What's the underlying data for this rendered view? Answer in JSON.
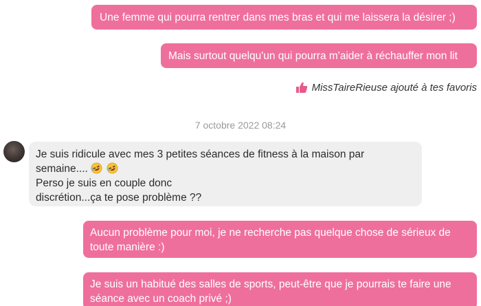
{
  "conversation": {
    "messages": [
      {
        "direction": "sent",
        "lines": [
          "Une femme qui pourra rentrer dans mes bras et qui me laissera la désirer ;)"
        ]
      },
      {
        "direction": "sent",
        "lines": [
          "Mais surtout quelqu'un qui pourra m'aider à réchauffer mon lit"
        ]
      },
      {
        "direction": "received",
        "lines": [
          "Je suis ridicule avec mes 3 petites séances de fitness à la maison par",
          "semaine....",
          "Perso je suis en couple donc",
          "discrétion...ça te pose problème ??"
        ],
        "emoji": [
          "rolling-on-floor-laughing",
          "rolling-on-floor-laughing"
        ]
      },
      {
        "direction": "sent",
        "lines": [
          "Aucun problème pour moi, je ne recherche pas quelque chose de sérieux de",
          "toute manière :)"
        ]
      },
      {
        "direction": "sent",
        "lines": [
          "Je suis un habitué des salles de sports, peut-être que je pourrais te faire une",
          "séance avec un coach privé ;)"
        ]
      }
    ],
    "favorite_notice": {
      "text": "MissTaireRieuse ajouté à tes favoris",
      "icon": "thumbs-up-icon"
    },
    "date_separator": "7 octobre 2022 08:24"
  },
  "colors": {
    "sent_bubble": "#ef6f9c",
    "received_bubble": "#efefef",
    "accent": "#e8598c"
  }
}
